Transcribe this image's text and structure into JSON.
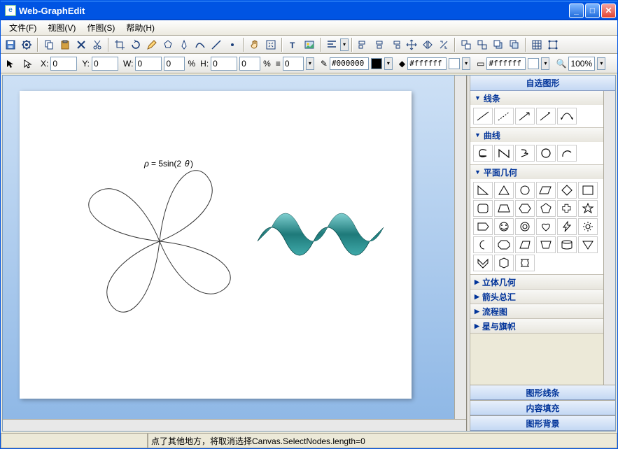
{
  "window": {
    "title": "Web-GraphEdit"
  },
  "menu": {
    "file": "文件(F)",
    "view": "视图(V)",
    "draw": "作图(S)",
    "help": "帮助(H)"
  },
  "props": {
    "x_label": "X:",
    "x": "0",
    "y_label": "Y:",
    "y": "0",
    "w_label": "W:",
    "w": "0",
    "w_pct": "0",
    "h_label": "H:",
    "h": "0",
    "h_pct": "0",
    "line_w": "0",
    "stroke": "#000000",
    "fill": "#ffffff",
    "bg": "#ffffff",
    "zoom": "100%",
    "pct_sym": "%"
  },
  "canvas": {
    "formula": "ρ = 5sin(2θ)"
  },
  "side": {
    "title": "自选图形",
    "cat_lines": "线条",
    "cat_curves": "曲线",
    "cat_plane": "平面几何",
    "cat_solid": "立体几何",
    "cat_arrows": "箭头总汇",
    "cat_flow": "流程图",
    "cat_stars": "星与旗帜",
    "btn_line": "图形线条",
    "btn_fill": "内容填充",
    "btn_bg": "图形背景"
  },
  "status": {
    "msg": "点了其他地方，将取消选择Canvas.SelectNodes.length=0"
  },
  "icons": {
    "save": "save-icon",
    "gear": "gear-icon",
    "copy": "copy-icon",
    "paste": "paste-icon",
    "delete": "delete-icon",
    "cut": "cut-icon",
    "crop": "crop-icon",
    "rotate": "rotate-icon",
    "pencil": "pencil-icon",
    "polygon": "polygon-icon",
    "pen": "pen-icon",
    "curve": "curve-icon",
    "line": "line-icon",
    "dot": "dot-icon",
    "hand": "hand-icon",
    "zoomfit": "zoomfit-icon",
    "text": "text-icon",
    "image": "image-icon",
    "align": "align-icon",
    "al": "align-left-icon",
    "ac": "align-center-icon",
    "ar": "align-right-icon",
    "move": "move-icon",
    "fliph": "flip-h-icon",
    "flipv": "flip-v-icon",
    "g1": "group-icon",
    "g2": "ungroup-icon",
    "g3": "front-icon",
    "g4": "back-icon",
    "g5": "grid-icon",
    "g6": "snap-icon"
  }
}
